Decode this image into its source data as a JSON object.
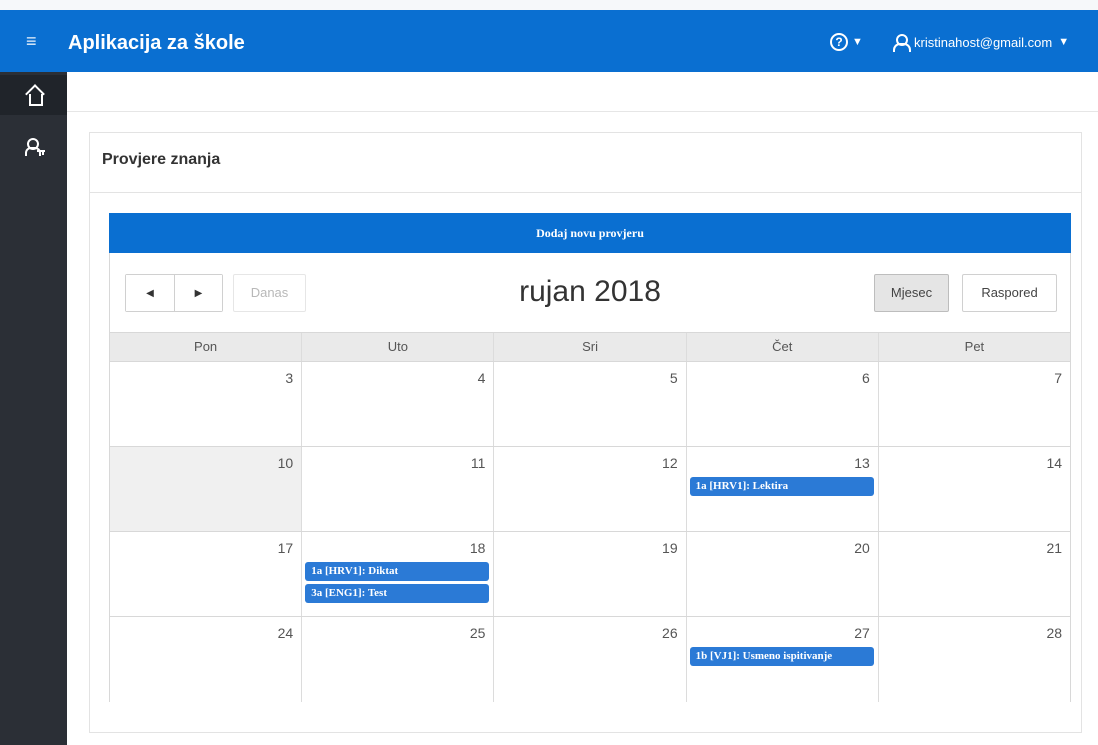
{
  "app": {
    "title": "Aplikacija za škole",
    "help_icon": "help-circle-icon",
    "user_email": "kristinahost@gmail.com"
  },
  "sidebar": {
    "items": [
      {
        "icon": "home-icon",
        "active": true
      },
      {
        "icon": "user-key-icon",
        "active": false
      }
    ]
  },
  "region": {
    "title": "Provjere znanja",
    "add_button": "Dodaj novu provjeru"
  },
  "calendar": {
    "today_button": "Danas",
    "month_title": "rujan 2018",
    "view_month": "Mjesec",
    "view_schedule": "Raspored",
    "weekdays": [
      "Pon",
      "Uto",
      "Sri",
      "Čet",
      "Pet"
    ],
    "weeks": [
      [
        {
          "day": "3",
          "events": []
        },
        {
          "day": "4",
          "events": []
        },
        {
          "day": "5",
          "events": []
        },
        {
          "day": "6",
          "events": []
        },
        {
          "day": "7",
          "events": []
        }
      ],
      [
        {
          "day": "10",
          "events": [],
          "today": true
        },
        {
          "day": "11",
          "events": []
        },
        {
          "day": "12",
          "events": []
        },
        {
          "day": "13",
          "events": [
            "1a [HRV1]: Lektira"
          ]
        },
        {
          "day": "14",
          "events": []
        }
      ],
      [
        {
          "day": "17",
          "events": []
        },
        {
          "day": "18",
          "events": [
            "1a [HRV1]: Diktat",
            "3a [ENG1]: Test"
          ]
        },
        {
          "day": "19",
          "events": []
        },
        {
          "day": "20",
          "events": []
        },
        {
          "day": "21",
          "events": []
        }
      ],
      [
        {
          "day": "24",
          "events": []
        },
        {
          "day": "25",
          "events": []
        },
        {
          "day": "26",
          "events": []
        },
        {
          "day": "27",
          "events": [
            "1b [VJ1]: Usmeno ispitivanje"
          ]
        },
        {
          "day": "28",
          "events": []
        }
      ]
    ]
  },
  "colors": {
    "header": "#0a6fd1",
    "sidebar": "#2b2f36",
    "event": "#2b7ad6",
    "today_cell": "#f0f0f0"
  }
}
